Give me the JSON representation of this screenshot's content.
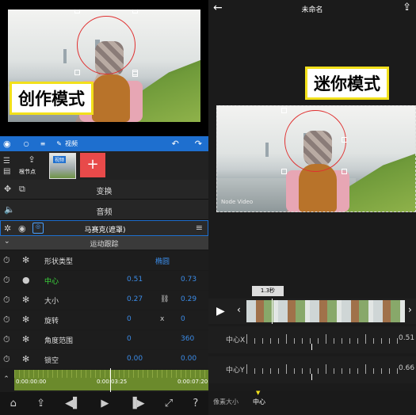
{
  "left": {
    "badge": "创作模式",
    "toolbar": {
      "layer_label": "视频",
      "undo_icon": "undo-icon",
      "redo_icon": "redo-icon"
    },
    "node_bar": {
      "root_label": "根节点",
      "clip_label": "视频",
      "add_label": "+"
    },
    "rows": {
      "transform": "变换",
      "audio": "音频",
      "effect_title": "马赛克(遮罩)",
      "motion_tracking": "运动跟踪"
    },
    "props": [
      {
        "label": "形状类型",
        "v1": "",
        "mid": "",
        "v2": "椭圆",
        "highlight": false
      },
      {
        "label": "中心",
        "v1": "0.51",
        "mid": "",
        "v2": "0.73",
        "highlight": true
      },
      {
        "label": "大小",
        "v1": "0.27",
        "mid": "link",
        "v2": "0.29",
        "highlight": false
      },
      {
        "label": "旋转",
        "v1": "0",
        "mid": "x",
        "v2": "0",
        "highlight": false
      },
      {
        "label": "角度范围",
        "v1": "0",
        "mid": "",
        "v2": "360",
        "highlight": false
      },
      {
        "label": "锁空",
        "v1": "0.00",
        "mid": "",
        "v2": "0.00",
        "highlight": false
      }
    ],
    "timeline": {
      "t0": "0:00:00:00",
      "t1": "0:00:03:25",
      "t2": "0:00:07:20"
    }
  },
  "right": {
    "title": "未命名",
    "badge": "迷你模式",
    "watermark": "Node Video",
    "duration": "1.3秒",
    "rulers": [
      {
        "label": "中心X",
        "value": "0.51"
      },
      {
        "label": "中心Y",
        "value": "0.66"
      }
    ],
    "tabs": [
      "像素大小",
      "中心"
    ]
  },
  "colors": {
    "accent_blue": "#1e6fcf",
    "highlight_green": "#3ddc3d",
    "value_blue": "#3b8ce8",
    "mask_red": "#e03030",
    "badge_border": "#f2e01b",
    "add_red": "#e84a4a"
  }
}
